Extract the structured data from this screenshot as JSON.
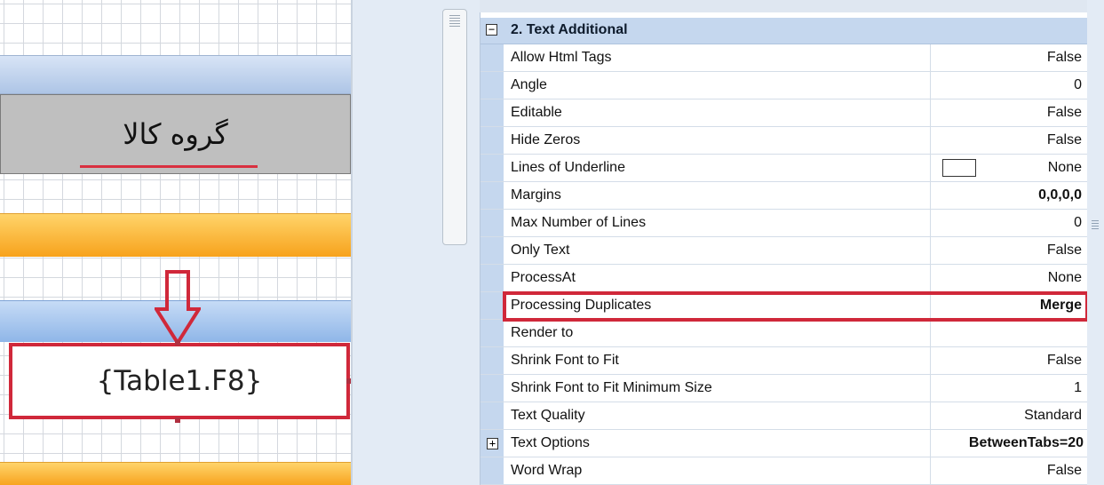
{
  "designer": {
    "header_text": "گروه کالا",
    "field_expression": "{Table1.F8}"
  },
  "property_grid": {
    "category": {
      "title": "2. Text  Additional",
      "toggle": "−"
    },
    "rows": [
      {
        "name": "Allow Html Tags",
        "value": "False"
      },
      {
        "name": "Angle",
        "value": "0"
      },
      {
        "name": "Editable",
        "value": "False"
      },
      {
        "name": "Hide Zeros",
        "value": "False"
      },
      {
        "name": "Lines of Underline",
        "value": "None"
      },
      {
        "name": "Margins",
        "value": "0,0,0,0"
      },
      {
        "name": "Max Number of Lines",
        "value": "0"
      },
      {
        "name": "Only Text",
        "value": "False"
      },
      {
        "name": "ProcessAt",
        "value": "None"
      },
      {
        "name": "Processing Duplicates",
        "value": "Merge"
      },
      {
        "name": "Render to",
        "value": ""
      },
      {
        "name": "Shrink Font to Fit",
        "value": "False"
      },
      {
        "name": "Shrink Font to Fit Minimum Size",
        "value": "1"
      },
      {
        "name": "Text Quality",
        "value": "Standard"
      },
      {
        "name": "Text Options",
        "value": "BetweenTabs=20",
        "expand": "+"
      },
      {
        "name": "Word Wrap",
        "value": "False"
      }
    ]
  },
  "colors": {
    "highlight": "#d0283a",
    "category_bg": "#c5d7ee",
    "band_orange": "#f7a21c",
    "band_blue": "#8fb6e8"
  }
}
